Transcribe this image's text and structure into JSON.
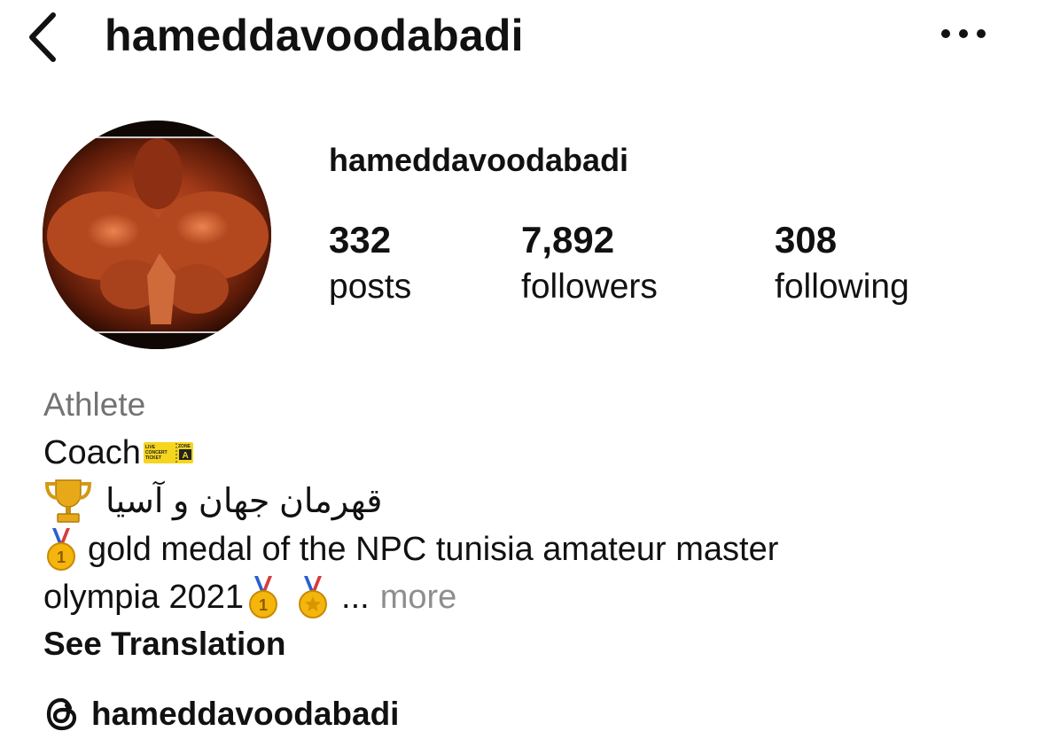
{
  "header": {
    "title": "hameddavoodabadi",
    "back_icon": "chevron-left-icon",
    "more_icon": "ellipsis-icon"
  },
  "profile": {
    "username": "hameddavoodabadi",
    "stats": [
      {
        "value": "332",
        "label": "posts"
      },
      {
        "value": "7,892",
        "label": "followers"
      },
      {
        "value": "308",
        "label": "following"
      }
    ]
  },
  "bio": {
    "category": "Athlete",
    "line1": "Coach",
    "ticket_icon": "concert-ticket-emoji",
    "ticket_texts": [
      "LIVE",
      "CONCERT",
      "TICKET",
      "ZONE",
      "A"
    ],
    "line2_rtl": "قهرمان جهان و آسیا",
    "trophy_icon": "trophy-emoji",
    "line3": "gold medal of the NPC tunisia amateur master",
    "line4": "olympia 2021",
    "medal_icons": [
      "first-place-medal-emoji",
      "sports-medal-emoji"
    ],
    "medal_digit": "1",
    "ellipsis": "...",
    "more_label": "more",
    "see_translation": "See Translation"
  },
  "threads": {
    "icon": "threads-icon",
    "handle": "hameddavoodabadi"
  },
  "colors": {
    "text": "#111111",
    "muted": "#737373",
    "more": "#8e8e8e",
    "background": "#ffffff"
  }
}
